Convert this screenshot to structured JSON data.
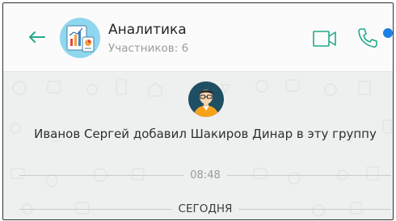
{
  "header": {
    "title": "Аналитика",
    "subtitle": "Участников: 6",
    "icons": {
      "back": "back-arrow-icon",
      "video": "video-call-icon",
      "call": "phone-call-icon",
      "status": "online-indicator"
    },
    "accent_color": "#23a88b",
    "status_color": "#1c7fe6"
  },
  "chat": {
    "system_message": "Иванов Сергей добавил Шакиров Динар в эту группу",
    "message_time": "08:48",
    "date_divider": "СЕГОДНЯ"
  }
}
